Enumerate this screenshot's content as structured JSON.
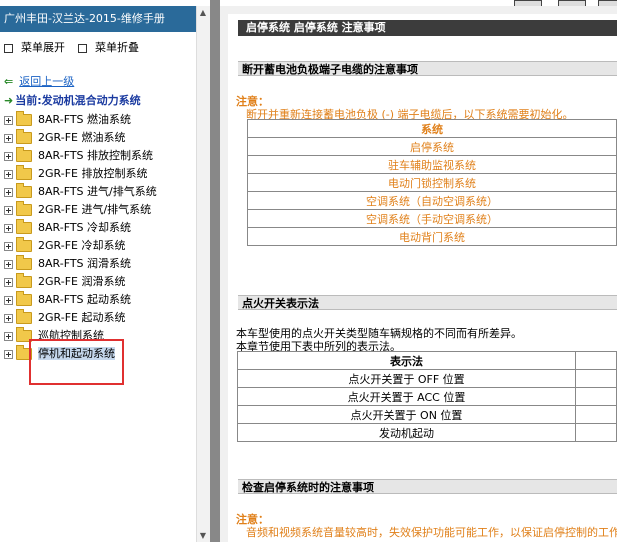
{
  "sidebar": {
    "title": "广州丰田-汉兰达-2015-维修手册",
    "expand_label": "菜单展开",
    "collapse_label": "菜单折叠",
    "back_label": "返回上一级",
    "current_label": "当前:发动机混合动力系统",
    "tree": [
      {
        "label": "8AR-FTS 燃油系统"
      },
      {
        "label": "2GR-FE 燃油系统"
      },
      {
        "label": "8AR-FTS 排放控制系统"
      },
      {
        "label": "2GR-FE 排放控制系统"
      },
      {
        "label": "8AR-FTS 进气/排气系统"
      },
      {
        "label": "2GR-FE 进气/排气系统"
      },
      {
        "label": "8AR-FTS 冷却系统"
      },
      {
        "label": "2GR-FE 冷却系统"
      },
      {
        "label": "8AR-FTS 润滑系统"
      },
      {
        "label": "2GR-FE 润滑系统"
      },
      {
        "label": "8AR-FTS 起动系统"
      },
      {
        "label": "2GR-FE 起动系统"
      },
      {
        "label": "巡航控制系统"
      },
      {
        "label": "停机和起动系统"
      }
    ]
  },
  "main": {
    "page_heading": "启停系统  启停系统  注意事项",
    "section1": {
      "heading": "断开蓄电池负极端子电缆的注意事项",
      "note_label": "注意：",
      "note_text": "断开并重新连接蓄电池负极 (-) 端子电缆后，以下系统需要初始化。",
      "table_header": "系统",
      "rows": [
        "启停系统",
        "驻车辅助监视系统",
        "电动门锁控制系统",
        "空调系统（自动空调系统）",
        "空调系统（手动空调系统）",
        "电动背门系统"
      ]
    },
    "section2": {
      "heading": "点火开关表示法",
      "para1": "本车型使用的点火开关类型随车辆规格的不同而有所差异。",
      "para2": "本章节使用下表中所列的表示法。",
      "table_header": "表示法",
      "rows": [
        "点火开关置于 OFF 位置",
        "点火开关置于 ACC 位置",
        "点火开关置于 ON 位置",
        "发动机起动"
      ]
    },
    "section3": {
      "heading": "检查启停系统时的注意事项",
      "note_label": "注意：",
      "note_text": "音频和视频系统音量较高时，失效保护功能可能工作，以保证启停控制的工作"
    }
  }
}
